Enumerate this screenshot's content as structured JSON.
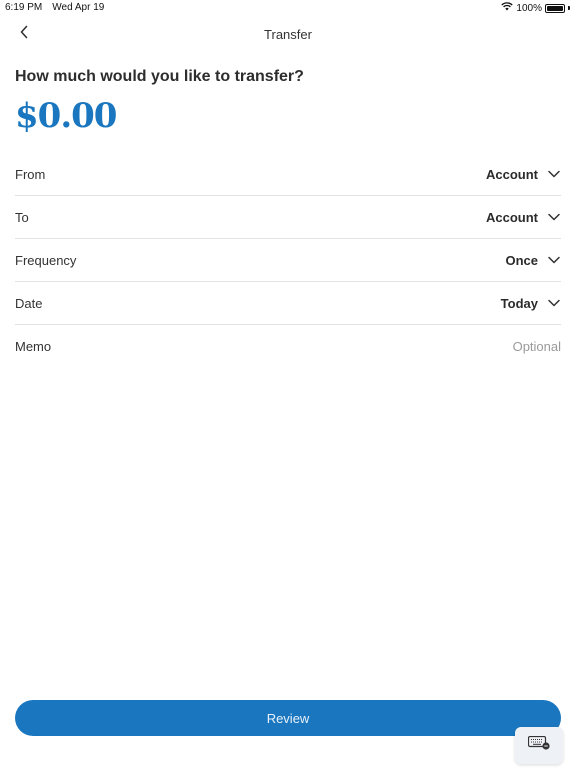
{
  "status_bar": {
    "time": "6:19 PM",
    "date": "Wed Apr 19",
    "battery": "100%",
    "icons": [
      "wifi-icon",
      "battery-icon"
    ]
  },
  "nav": {
    "title": "Transfer",
    "back_icon": "chevron-left-icon"
  },
  "question": "How much would you like to transfer?",
  "amount": "$0.00",
  "form": {
    "rows": [
      {
        "label": "From",
        "value": "Account",
        "icon": "chevron-down-icon"
      },
      {
        "label": "To",
        "value": "Account",
        "icon": "chevron-down-icon"
      },
      {
        "label": "Frequency",
        "value": "Once",
        "icon": "chevron-down-icon"
      },
      {
        "label": "Date",
        "value": "Today",
        "icon": "chevron-down-icon"
      }
    ],
    "memo": {
      "label": "Memo",
      "value": "",
      "placeholder": "Optional"
    }
  },
  "review_button": "Review",
  "keyboard_button_icon": "keyboard-dismiss-icon",
  "colors": {
    "accent": "#1a77bf"
  }
}
